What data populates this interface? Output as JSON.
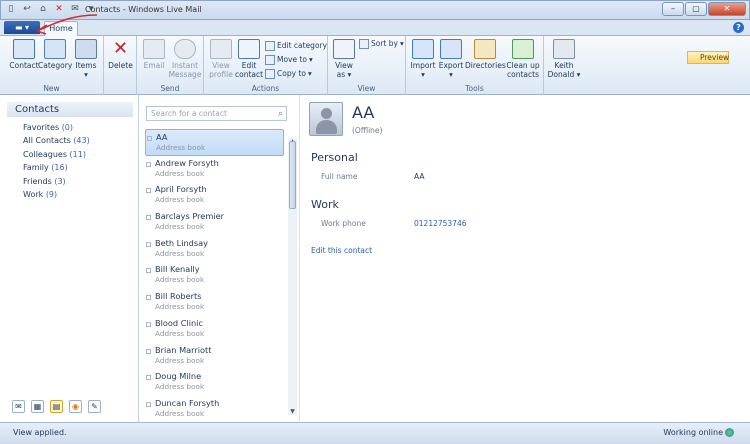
{
  "window": {
    "title": "Contacts - Windows Live Mail",
    "tab_home": "Home"
  },
  "ribbon": {
    "groups": {
      "new": "New",
      "send": "Send",
      "actions": "Actions",
      "view": "View",
      "tools": "Tools"
    },
    "new": {
      "contact": "Contact",
      "category": "Category",
      "items": "Items"
    },
    "delete": "Delete",
    "send": {
      "email": "Email",
      "instant": "Instant",
      "message": "Message"
    },
    "actions": {
      "view": "View",
      "profile": "profile",
      "edit": "Edit",
      "contact": "contact",
      "edit_category": "Edit category",
      "move_to": "Move to",
      "copy_to": "Copy to"
    },
    "view": {
      "view": "View",
      "as": "as",
      "sort_by": "Sort by",
      "preview": "Preview"
    },
    "tools": {
      "import": "Import",
      "export": "Export",
      "directories": "Directories",
      "clean": "Clean up",
      "contacts": "contacts",
      "keith": "Keith",
      "donald": "Donald"
    }
  },
  "sidebar": {
    "title": "Contacts",
    "items": [
      {
        "label": "Favorites",
        "count": "(0)"
      },
      {
        "label": "All Contacts",
        "count": "(43)"
      },
      {
        "label": "Colleagues",
        "count": "(11)"
      },
      {
        "label": "Family",
        "count": "(16)"
      },
      {
        "label": "Friends",
        "count": "(3)"
      },
      {
        "label": "Work",
        "count": "(9)"
      }
    ]
  },
  "search": {
    "placeholder": "Search for a contact"
  },
  "contacts": [
    {
      "name": "AA",
      "source": "Address book"
    },
    {
      "name": "Andrew Forsyth",
      "source": "Address book"
    },
    {
      "name": "April Forsyth",
      "source": "Address book"
    },
    {
      "name": "Barclays Premier",
      "source": "Address book"
    },
    {
      "name": "Beth Lindsay",
      "source": "Address book"
    },
    {
      "name": "Bill Kenally",
      "source": "Address book"
    },
    {
      "name": "Bill Roberts",
      "source": "Address book"
    },
    {
      "name": "Blood Clinic",
      "source": "Address book"
    },
    {
      "name": "Brian Marriott",
      "source": "Address book"
    },
    {
      "name": "Doug Milne",
      "source": "Address book"
    },
    {
      "name": "Duncan Forsyth",
      "source": "Address book"
    }
  ],
  "detail": {
    "name": "AA",
    "status": "(Offline)",
    "personal_heading": "Personal",
    "full_name_label": "Full name",
    "full_name_value": "AA",
    "work_heading": "Work",
    "work_phone_label": "Work phone",
    "work_phone_value": "01212753746",
    "edit_link": "Edit this contact"
  },
  "status": {
    "left": "View applied.",
    "right": "Working online"
  }
}
